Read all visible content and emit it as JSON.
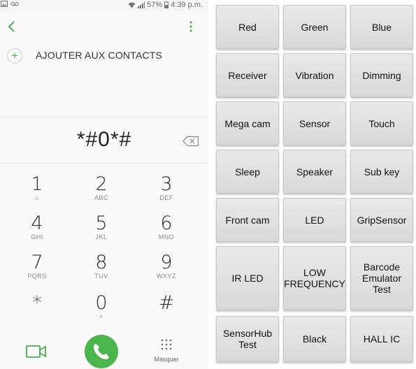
{
  "status_bar": {
    "battery": "57%",
    "time": "4:39 p.m."
  },
  "dialer": {
    "add_contact_label": "AJOUTER AUX CONTACTS",
    "add_icon": "+",
    "number": "*#0*#",
    "keys": [
      {
        "digit": "1",
        "letters": "⌂"
      },
      {
        "digit": "2",
        "letters": "ABC"
      },
      {
        "digit": "3",
        "letters": "DEF"
      },
      {
        "digit": "4",
        "letters": "GHI"
      },
      {
        "digit": "5",
        "letters": "JKL"
      },
      {
        "digit": "6",
        "letters": "MNO"
      },
      {
        "digit": "7",
        "letters": "PQRS"
      },
      {
        "digit": "8",
        "letters": "TUV"
      },
      {
        "digit": "9",
        "letters": "WXYZ"
      },
      {
        "digit": "*",
        "letters": ""
      },
      {
        "digit": "0",
        "letters": "+"
      },
      {
        "digit": "#",
        "letters": ""
      }
    ],
    "hide_label": "Masquer",
    "accent_color": "#4ab54a"
  },
  "test_buttons": [
    "Red",
    "Green",
    "Blue",
    "Receiver",
    "Vibration",
    "Dimming",
    "Mega cam",
    "Sensor",
    "Touch",
    "Sleep",
    "Speaker",
    "Sub key",
    "Front cam",
    "LED",
    "GripSensor",
    "IR LED",
    "LOW FREQUENCY",
    "Barcode Emulator Test",
    "SensorHub Test",
    "Black",
    "HALL IC"
  ]
}
